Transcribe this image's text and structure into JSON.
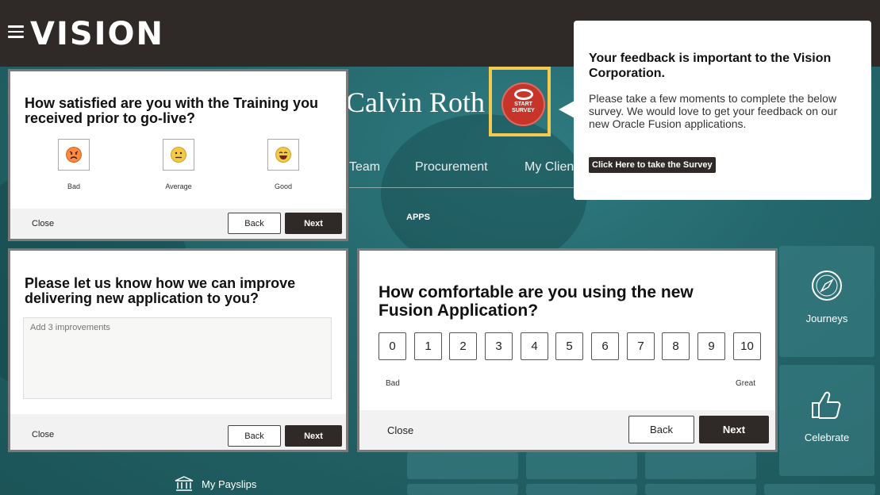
{
  "header": {
    "logo": "VISION"
  },
  "profile": {
    "name": "Calvin Roth",
    "survey_badge": "START\nSURVEY"
  },
  "nav": {
    "tabs": [
      "Team",
      "Procurement",
      "My Clien"
    ]
  },
  "apps_label": "APPS",
  "tiles": {
    "journeys": "Journeys",
    "celebrate": "Celebrate",
    "payslips": "My Payslips"
  },
  "tooltip": {
    "title": "Your feedback is important to the Vision Corporation.",
    "body": "Please take a few moments to complete the below survey. We would love to get your feedback on our new Oracle Fusion applications.",
    "button": "Click Here to take the Survey"
  },
  "survey_training": {
    "question": "How satisfied are you with the Training you received prior to go-live?",
    "options": [
      {
        "label": "Bad",
        "icon": "angry-face-icon",
        "color": "#ff8a3d"
      },
      {
        "label": "Average",
        "icon": "neutral-face-icon",
        "color": "#f6c945"
      },
      {
        "label": "Good",
        "icon": "happy-face-icon",
        "color": "#f6c945"
      }
    ],
    "close": "Close",
    "back": "Back",
    "next": "Next"
  },
  "survey_improve": {
    "question": "Please let us know how we can improve delivering new application to you?",
    "placeholder": "Add 3 improvements",
    "close": "Close",
    "back": "Back",
    "next": "Next"
  },
  "survey_comfort": {
    "question": "How comfortable are you using the new Fusion Application?",
    "scale": [
      "0",
      "1",
      "2",
      "3",
      "4",
      "5",
      "6",
      "7",
      "8",
      "9",
      "10"
    ],
    "low_label": "Bad",
    "high_label": "Great",
    "close": "Close",
    "back": "Back",
    "next": "Next"
  },
  "colors": {
    "accent_yellow": "#f3c94f",
    "survey_red": "#c7342a",
    "dark": "#2f2a28",
    "teal": "#23666b"
  }
}
